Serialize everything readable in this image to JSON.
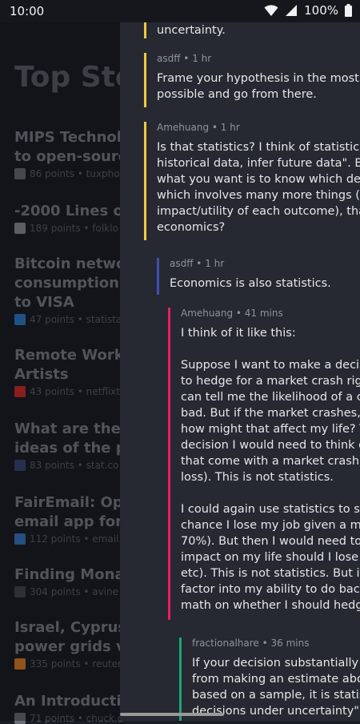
{
  "status_bar": {
    "time": "10:00",
    "battery": "100%"
  },
  "background": {
    "title": "Top Sto",
    "stories": [
      {
        "title_lines": [
          "MIPS Technolog",
          "to open-source"
        ],
        "meta": "86 points • tuxpho",
        "favicon_color": "#6b6f78"
      },
      {
        "title_lines": [
          "-2000 Lines of"
        ],
        "meta": "189 points • folklo",
        "favicon_color": "#8c9199"
      },
      {
        "title_lines": [
          "Bitcoin networ",
          "consumption p",
          "to VISA"
        ],
        "meta": "47 points • statista",
        "favicon_color": "#2f7fd0"
      },
      {
        "title_lines": [
          "Remote Worksh",
          "Artists"
        ],
        "meta": "43 points • netflixt",
        "favicon_color": "#d32f2f"
      },
      {
        "title_lines": [
          "What are the m",
          "ideas of the pa"
        ],
        "meta": "83 points • stat.co",
        "favicon_color": "#3a4a7a"
      },
      {
        "title_lines": [
          "FairEmail: Ope",
          "email app for A"
        ],
        "meta": "112 points • email.f",
        "favicon_color": "#3b78c4"
      },
      {
        "title_lines": [
          "Finding Mona L"
        ],
        "meta": "304 points • avine",
        "favicon_color": "#444950"
      },
      {
        "title_lines": [
          "Israel, Cyprus a",
          "power grids via"
        ],
        "meta": "335 points • reuter",
        "favicon_color": "#d9822b"
      },
      {
        "title_lines": [
          "An Introductio"
        ],
        "meta": "71 points • chuck.d",
        "favicon_color": "#6b6f78"
      }
    ]
  },
  "comments": [
    {
      "author": "",
      "time": "",
      "color": "#f2c744",
      "lines": [
        [
          "uncertainty."
        ]
      ]
    },
    {
      "author": "asdff",
      "time": "1 hr",
      "color": "#f2c744",
      "lines": [
        [
          "Frame your hypothesis in the most s",
          "possible and go from there."
        ]
      ]
    },
    {
      "author": "Amehuang",
      "time": "1 hr",
      "color": "#f2c744",
      "lines": [
        [
          "Is that statistics? I think of statistics",
          "historical data, infer future data\". Bu",
          "what you want is to know which dec",
          "which involves many more things (lik",
          "impact/utility of each outcome), tha",
          "economics?"
        ]
      ]
    },
    {
      "author": "asdff",
      "time": "1 hr",
      "color": "#3f51b5",
      "lines": [
        [
          "Economics is also statistics."
        ]
      ]
    },
    {
      "author": "Amehuang",
      "time": "41 mins",
      "color": "#e91e63",
      "lines": [
        [
          "I think of it like this:"
        ],
        [
          "Suppose I want to make a decisi",
          "to hedge for a market crash righ",
          "can tell me the likelihood of a cr",
          "bad. But if the market crashes, a",
          "how might that affect my life? T",
          "decision I would need to think o",
          "that come with a market crash (",
          "loss). This is not statistics."
        ],
        [
          "I could again use statistics to sa",
          "chance I lose my job given a ma",
          "70%). But then I would need to e",
          "impact on my life should I lose m",
          "etc). This is not statistics. But it",
          "factor into my ability to do back",
          "math on whether I should hedge"
        ]
      ]
    },
    {
      "author": "fractionalhare",
      "time": "36 mins",
      "color": "#1ea672",
      "lines": [
        [
          "If your decision substantially i",
          "from making an estimate abo",
          "based on a sample, it is statist",
          "decisions under uncertainty\" i"
        ]
      ]
    }
  ]
}
